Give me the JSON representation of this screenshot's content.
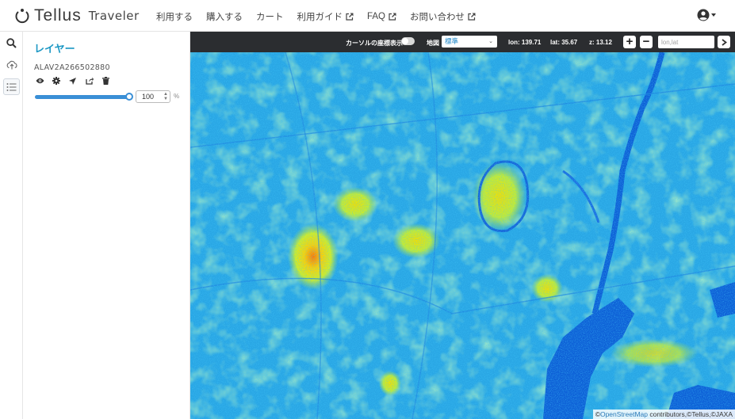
{
  "header": {
    "logo_text": "Tellus",
    "logo_sub": "Traveler",
    "nav": [
      {
        "label": "利用する",
        "external": false
      },
      {
        "label": "購入する",
        "external": false
      },
      {
        "label": "カート",
        "external": false
      },
      {
        "label": "利用ガイド",
        "external": true
      },
      {
        "label": "FAQ",
        "external": true
      },
      {
        "label": "お問い合わせ",
        "external": true
      }
    ],
    "account_icon": "account-circle-icon"
  },
  "rail": {
    "icons": [
      "search-icon",
      "upload-cloud-icon",
      "layer-list-icon"
    ]
  },
  "panel": {
    "title": "レイヤー",
    "layer_name": "ALAV2A266502880",
    "tools": [
      "eye-icon",
      "gear-icon",
      "location-arrow-icon",
      "share-icon",
      "trash-icon"
    ],
    "opacity_value": "100",
    "opacity_unit": "%",
    "opacity_level": 1.0
  },
  "toolbar": {
    "cursor_coords_label": "カーソルの座標表示",
    "map_label": "地図",
    "map_select": "標準",
    "lon": "lon: 139.71",
    "lat": "lat: 35.67",
    "zoom": "z: 13.12",
    "zoom_in": "+",
    "zoom_out": "−",
    "coord_placeholder": "lon,lat"
  },
  "attribution": {
    "prefix": "©",
    "osm": "OpenStreetMap",
    "rest": " contributors,©Tellus,©JAXA"
  },
  "colors": {
    "accent": "#1d98c4",
    "toolbar_bg": "#2b2d30",
    "slider": "#3a8fd6"
  }
}
